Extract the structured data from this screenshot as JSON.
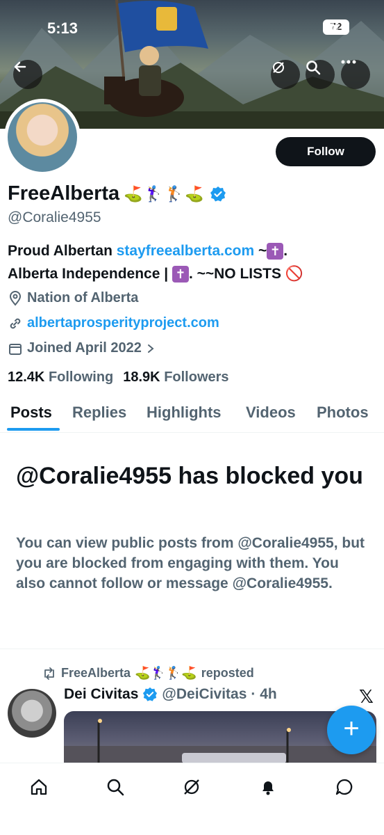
{
  "status_bar": {
    "time": "5:13",
    "battery": "72"
  },
  "profile": {
    "display_name": "FreeAlberta",
    "name_emojis": "⛳🏌️‍♀️🏌️⛳",
    "handle": "@Coralie4955",
    "follow_label": "Follow",
    "bio_part1": "Proud Albertan ",
    "bio_link": "stayfreealberta.com",
    "bio_part2": " ~",
    "bio_cross": "✝",
    "bio_part3": ".",
    "bio_line2a": "Alberta Independence | ",
    "bio_line2b": ". ~~NO LISTS ",
    "bio_no": "🚫",
    "location": "Nation of Alberta",
    "website": "albertaprosperityproject.com",
    "joined": "Joined April 2022",
    "following_count": "12.4K",
    "following_label": "Following",
    "followers_count": "18.9K",
    "followers_label": "Followers"
  },
  "tabs": [
    "Posts",
    "Replies",
    "Highlights",
    "Videos",
    "Photos"
  ],
  "blocked": {
    "title": "@Coralie4955 has blocked you",
    "description": "You can view public posts from @Coralie4955, but you are blocked from engaging with them. You also cannot follow or message @Coralie4955."
  },
  "post": {
    "repost_name": "FreeAlberta",
    "repost_emojis": "⛳🏌️‍♀️🏌️⛳",
    "repost_suffix": "reposted",
    "author_name": "Dei Civitas",
    "author_handle": "@DeiCivitas",
    "author_time": "· 4h",
    "x_glyph": "𝕏"
  },
  "fab_label": "+",
  "colors": {
    "accent": "#1d9bf0",
    "text": "#0f1419",
    "muted": "#536471"
  },
  "icons": [
    "back-arrow-icon",
    "grok-icon",
    "search-icon",
    "more-icon",
    "location-pin-icon",
    "link-icon",
    "calendar-icon",
    "chevron-right-icon",
    "repost-icon",
    "verified-icon",
    "home-icon",
    "search-icon",
    "grok-icon",
    "notifications-bell-icon",
    "messages-icon"
  ]
}
